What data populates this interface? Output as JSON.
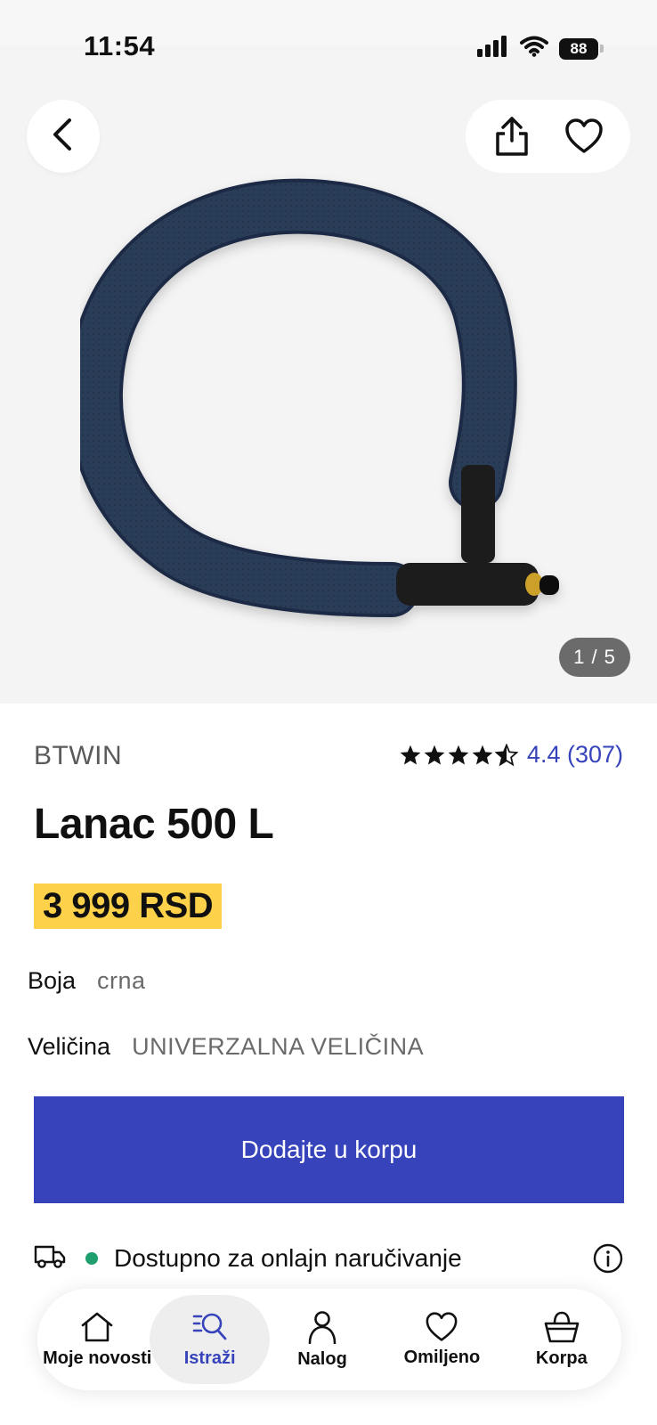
{
  "status_bar": {
    "time": "11:54",
    "battery": "88"
  },
  "gallery": {
    "counter": "1 / 5",
    "image_alt": "black chain lock with blue fabric cover"
  },
  "product": {
    "brand": "BTWIN",
    "rating_value": "4.4",
    "rating_count": "(307)",
    "rating_text": "4.4 (307)",
    "stars": 4.5,
    "title": "Lanac 500 L",
    "price": "3 999 RSD"
  },
  "attributes": {
    "color_label": "Boja",
    "color_value": "crna",
    "size_label": "Veličina",
    "size_value": "UNIVERZALNA VELIČINA"
  },
  "cart_button_label": "Dodajte u korpu",
  "availability": "Dostupno za onlajn naručivanje",
  "tabs": [
    {
      "label": "Moje novosti",
      "icon": "home-icon"
    },
    {
      "label": "Istraži",
      "icon": "explore-icon",
      "active": true
    },
    {
      "label": "Nalog",
      "icon": "account-icon"
    },
    {
      "label": "Omiljeno",
      "icon": "heart-icon"
    },
    {
      "label": "Korpa",
      "icon": "basket-icon"
    }
  ],
  "colors": {
    "accent": "#3643ba",
    "price_highlight": "#fdd14a",
    "available": "#1f9e6e"
  }
}
